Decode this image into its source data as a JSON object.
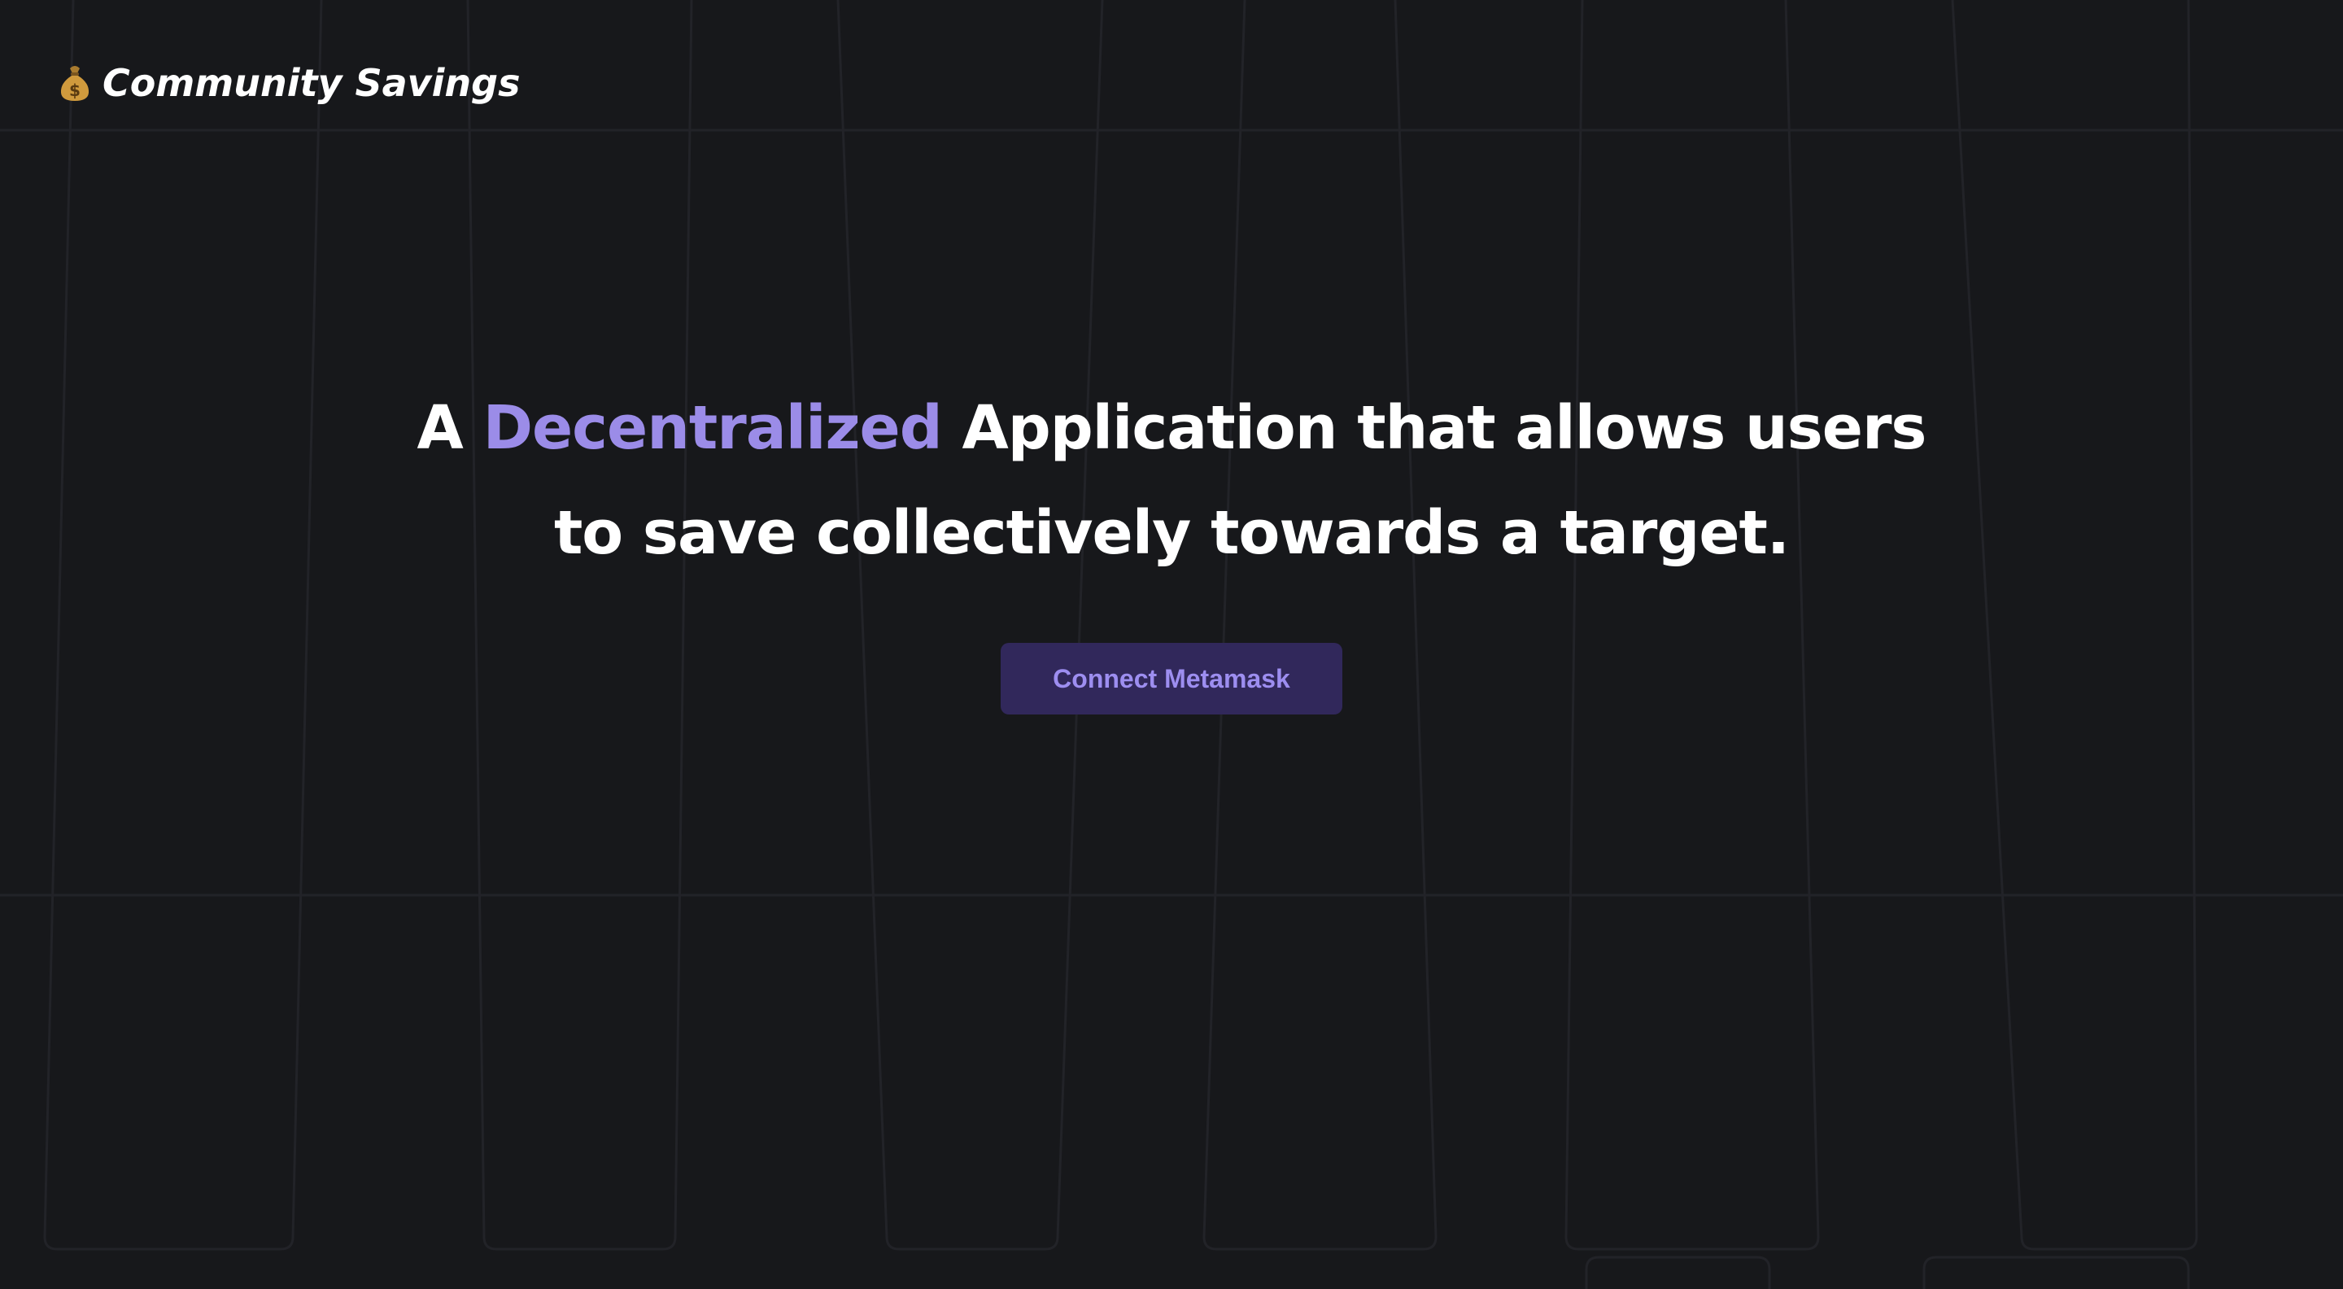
{
  "header": {
    "logo_icon": "money-bag-icon",
    "title": "Community Savings"
  },
  "hero": {
    "headline_prefix": "A",
    "headline_highlight": "Decentralized",
    "headline_line1_rest": "Application that allows users",
    "headline_line2": "to save collectively towards a target."
  },
  "actions": {
    "connect_label": "Connect Metamask"
  },
  "colors": {
    "background": "#17181b",
    "accent": "#9b8ce8",
    "button_background": "#31285b",
    "text": "#ffffff"
  }
}
